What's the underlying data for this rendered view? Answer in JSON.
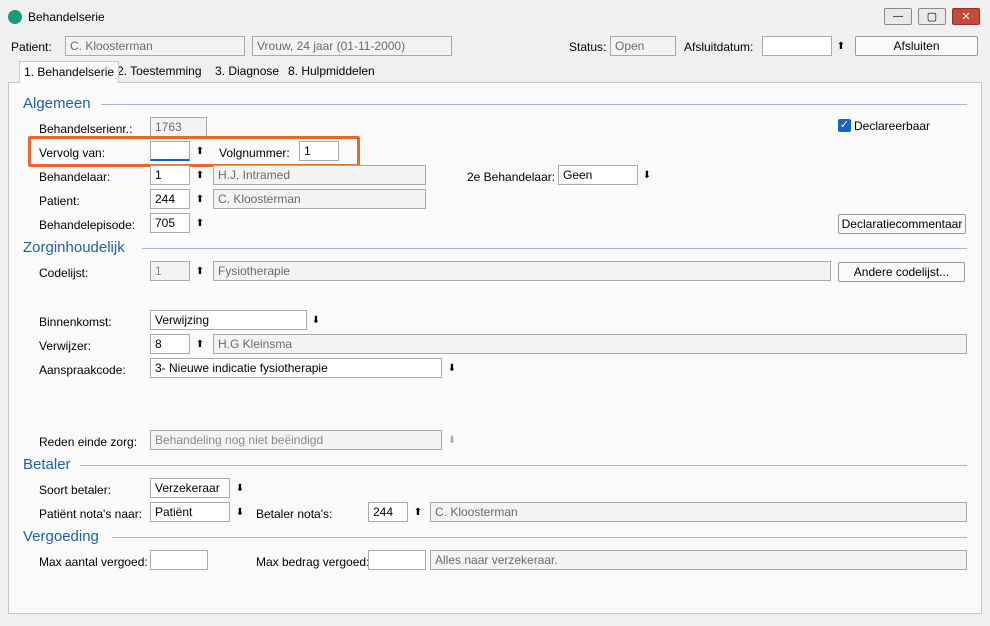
{
  "window": {
    "title": "Behandelserie"
  },
  "header": {
    "patient_label": "Patient:",
    "patient_name": "C. Kloosterman",
    "patient_info": "Vrouw, 24 jaar (01-11-2000)",
    "status_label": "Status:",
    "status_value": "Open",
    "afsluitdatum_label": "Afsluitdatum:",
    "afsluitdatum_value": "",
    "afsluiten_button": "Afsluiten"
  },
  "tabs": [
    {
      "label": "1. Behandelserie"
    },
    {
      "label": "2. Toestemming"
    },
    {
      "label": "3. Diagnose"
    },
    {
      "label": "8. Hulpmiddelen"
    }
  ],
  "algemeen": {
    "section_title": "Algemeen",
    "behandelserienr_label": "Behandelserienr.:",
    "behandelserienr_value": "1763",
    "declareerbaar_label": "Declareerbaar",
    "vervolg_label": "Vervolg van:",
    "vervolg_value": "",
    "volgnummer_label": "Volgnummer:",
    "volgnummer_value": "1",
    "behandelaar_label": "Behandelaar:",
    "behandelaar_code": "1",
    "behandelaar_name": "H.J. Intramed",
    "behandelaar2_label": "2e Behandelaar:",
    "behandelaar2_value": "Geen",
    "patient_label": "Patient:",
    "patient_code": "244",
    "patient_name": "C. Kloosterman",
    "episode_label": "Behandelepisode:",
    "episode_value": "705",
    "declaratiecommentaar_button": "Declaratiecommentaar"
  },
  "zorginhoudelijk": {
    "section_title": "Zorginhoudelijk",
    "codelijst_label": "Codelijst:",
    "codelijst_code": "1",
    "codelijst_name": "Fysiotherapie",
    "andere_button": "Andere codelijst...",
    "binnenkomst_label": "Binnenkomst:",
    "binnenkomst_value": "Verwijzing",
    "verwijzer_label": "Verwijzer:",
    "verwijzer_code": "8",
    "verwijzer_name": "H.G Kleinsma",
    "aanspraak_label": "Aanspraakcode:",
    "aanspraak_value": "3- Nieuwe indicatie fysiotherapie",
    "reden_label": "Reden einde zorg:",
    "reden_value": "Behandeling nog niet beëindigd"
  },
  "betaler": {
    "section_title": "Betaler",
    "soort_label": "Soort betaler:",
    "soort_value": "Verzekeraar",
    "notas_naar_label": "Patiënt nota's naar:",
    "notas_naar_value": "Patiënt",
    "betaler_notas_label": "Betaler nota's:",
    "betaler_notas_code": "244",
    "betaler_notas_name": "C. Kloosterman"
  },
  "vergoeding": {
    "section_title": "Vergoeding",
    "max_aantal_label": "Max aantal vergoed:",
    "max_aantal_value": "",
    "max_bedrag_label": "Max bedrag vergoed:",
    "max_bedrag_value": "",
    "max_bedrag_note": "Alles naar verzekeraar."
  },
  "icons": {
    "lookup_up": "⬆",
    "dropdown": "⬇",
    "check": "✓",
    "minimize": "—",
    "maximize": "▢",
    "close": "✕"
  }
}
